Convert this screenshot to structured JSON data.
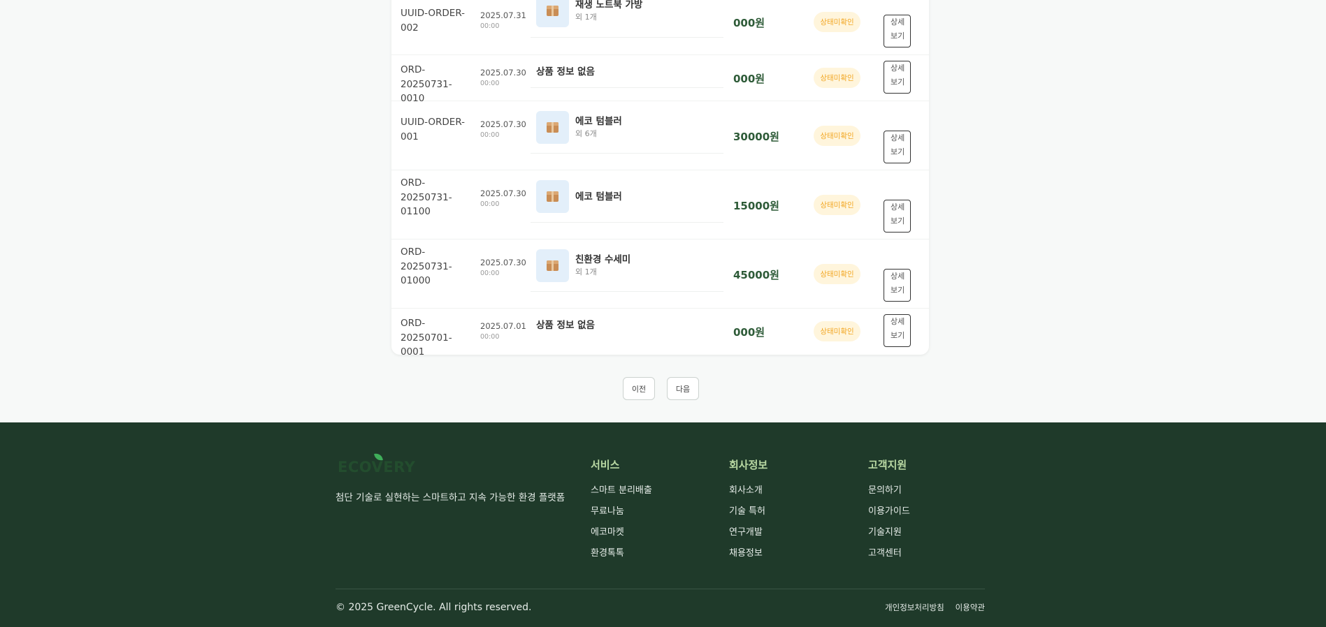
{
  "orders": [
    {
      "id": "UUID-ORDER-002",
      "date": "2025.07.31",
      "time": "00:00",
      "product": "재생 노트북 가방",
      "extra": "외 1개",
      "amount": "000원",
      "status": "상태미확인",
      "action": "상세보기"
    },
    {
      "id": "ORD-20250731-0010",
      "date": "2025.07.30",
      "time": "00:00",
      "product": "상품 정보 없음",
      "extra": "",
      "amount": "000원",
      "status": "상태미확인",
      "action": "상세보기"
    },
    {
      "id": "UUID-ORDER-001",
      "date": "2025.07.30",
      "time": "00:00",
      "product": "에코 텀블러",
      "extra": "외 6개",
      "amount": "30000원",
      "status": "상태미확인",
      "action": "상세보기"
    },
    {
      "id": "ORD-20250731-01100",
      "date": "2025.07.30",
      "time": "00:00",
      "product": "에코 텀블러",
      "extra": "",
      "amount": "15000원",
      "status": "상태미확인",
      "action": "상세보기"
    },
    {
      "id": "ORD-20250731-01000",
      "date": "2025.07.30",
      "time": "00:00",
      "product": "친환경 수세미",
      "extra": "외 1개",
      "amount": "45000원",
      "status": "상태미확인",
      "action": "상세보기"
    },
    {
      "id": "ORD-20250701-0001",
      "date": "2025.07.01",
      "time": "00:00",
      "product": "상품 정보 없음",
      "extra": "",
      "amount": "000원",
      "status": "상태미확인",
      "action": "상세보기"
    }
  ],
  "pagination": {
    "prev": "이전",
    "next": "다음"
  },
  "footer": {
    "logo": "ECOVERY",
    "tagline": "첨단 기술로 실현하는 스마트하고 지속 가능한 환경 플랫폼",
    "columns": [
      {
        "title": "서비스",
        "links": [
          "스마트 분리배출",
          "무료나눔",
          "에코마켓",
          "환경톡톡"
        ]
      },
      {
        "title": "회사정보",
        "links": [
          "회사소개",
          "기술 특허",
          "연구개발",
          "채용정보"
        ]
      },
      {
        "title": "고객지원",
        "links": [
          "문의하기",
          "이용가이드",
          "기술지원",
          "고객센터"
        ]
      }
    ],
    "copyright": "© 2025 GreenCycle. All rights reserved.",
    "legal": [
      "개인정보처리방침",
      "이용약관"
    ]
  },
  "colors": {
    "accent": "#2e5b38",
    "status_bg": "#fff5dc",
    "status_text": "#f2a724",
    "footer_bg": "#1f3a2a",
    "footer_heading": "#b9d9a3"
  },
  "icons": {
    "product_thumb": "package-icon"
  }
}
